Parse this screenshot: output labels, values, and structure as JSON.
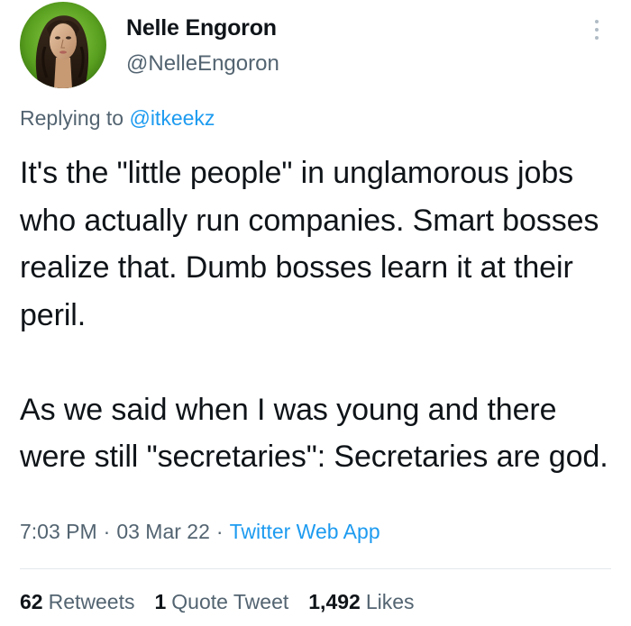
{
  "author": {
    "name": "Nelle Engoron",
    "handle": "@NelleEngoron"
  },
  "reply": {
    "prefix": "Replying to ",
    "mention": "@itkeekz"
  },
  "tweet": {
    "text": "It's the \"little people\" in unglamorous jobs who actually run companies. Smart bosses realize that. Dumb bosses learn it at their peril.\n\nAs we said when I was young and there were still \"secretaries\": Secretaries are god."
  },
  "meta": {
    "time": "7:03 PM",
    "separator": "·",
    "date": "03 Mar 22",
    "source": "Twitter Web App"
  },
  "stats": {
    "retweets_count": "62",
    "retweets_label": "Retweets",
    "quotes_count": "1",
    "quotes_label": "Quote Tweet",
    "likes_count": "1,492",
    "likes_label": "Likes"
  },
  "colors": {
    "link": "#1d9bf0",
    "secondary_text": "#536471",
    "primary_text": "#0f1419"
  },
  "icons": {
    "more": "more-horizontal-icon",
    "avatar": "profile-avatar"
  }
}
